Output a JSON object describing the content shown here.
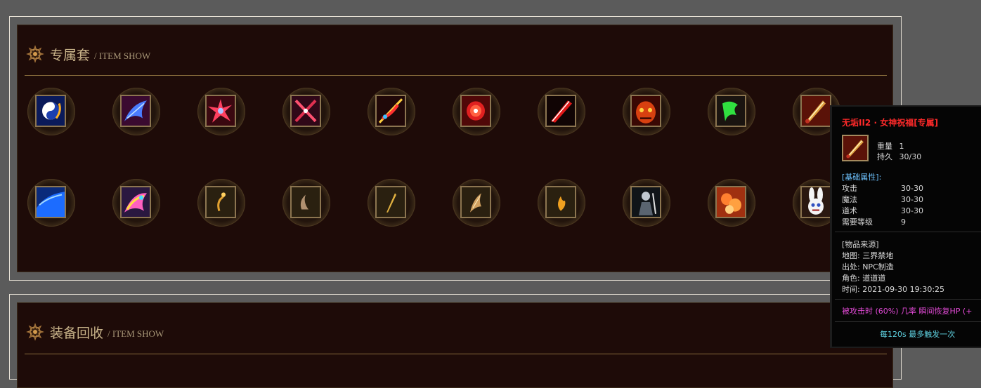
{
  "sections": [
    {
      "title": "专属套",
      "subtitle": "/ ITEM SHOW"
    },
    {
      "title": "装备回收",
      "subtitle": "/ ITEM SHOW"
    }
  ],
  "icons": {
    "section_emblem": "dragon-emblem-icon"
  },
  "colors": {
    "panel_bg": "#1e0b08",
    "divider": "#8a6d3d",
    "item_name": "#ff2a2a",
    "attr_header": "#6ec3ff",
    "effect": "#e24ad6",
    "trigger": "#5fd3e2"
  },
  "items_row1": [
    "taiji-item-icon",
    "blue-dragon-item-icon",
    "red-burst-item-icon",
    "crossed-blades-item-icon",
    "jeweled-sword-item-icon",
    "fire-orb-item-icon",
    "crimson-blade-item-icon",
    "demon-face-item-icon",
    "green-dragon-item-icon",
    "golden-sword-item-icon"
  ],
  "items_row2": [
    "blue-wave-item-icon",
    "rainbow-dragon-item-icon",
    "gold-hook-item-icon",
    "curved-horn-item-icon",
    "gold-dagger-item-icon",
    "gold-wing-item-icon",
    "gold-flame-item-icon",
    "dark-warrior-item-icon",
    "fire-cloud-item-icon",
    "rabbit-mask-item-icon"
  ],
  "tooltip": {
    "name": "无垢ⅠⅠ2 · 女神祝福[专属]",
    "weight_label": "重量",
    "weight_value": "1",
    "durability_label": "持久",
    "durability_value": "30/30",
    "base_header": "[基础属性]:",
    "attrs": [
      {
        "label": "攻击",
        "value": "30-30"
      },
      {
        "label": "魔法",
        "value": "30-30"
      },
      {
        "label": "道术",
        "value": "30-30"
      },
      {
        "label": "需要等级",
        "value": "9"
      }
    ],
    "source_header": "[物品来源]",
    "source_lines": [
      "地图: 三界禁地",
      "出处: NPC制造",
      "角色: 道道道",
      "时间: 2021-09-30 19:30:25"
    ],
    "effect_text": "被攻击时 (60%) 几率   瞬间恢复HP (+",
    "trigger_text": "每120s 最多触发一次"
  }
}
